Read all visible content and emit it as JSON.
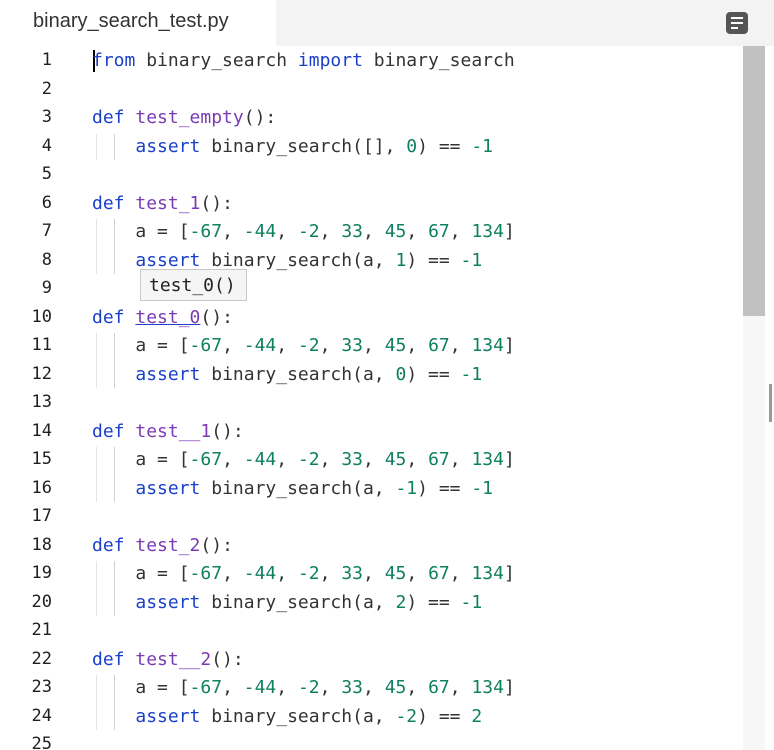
{
  "tab": {
    "title": "binary_search_test.py"
  },
  "tooltip": {
    "text": "test_0()"
  },
  "colors": {
    "keyword": "#1a3fc9",
    "function": "#7a3ab5",
    "number": "#0e7f5f",
    "text": "#333333"
  },
  "icons": {
    "outline": "outline-icon"
  },
  "lines": [
    {
      "n": "1",
      "tokens": [
        [
          "from",
          "kw"
        ],
        [
          " binary_search ",
          ""
        ],
        [
          "import",
          "kw"
        ],
        [
          " binary_search",
          ""
        ]
      ]
    },
    {
      "n": "2",
      "tokens": []
    },
    {
      "n": "3",
      "tokens": [
        [
          "def",
          "kw"
        ],
        [
          " ",
          ""
        ],
        [
          "test_empty",
          "fn"
        ],
        [
          "():",
          ""
        ]
      ]
    },
    {
      "n": "4",
      "tokens": [
        [
          "    ",
          ""
        ],
        [
          "assert",
          "kw"
        ],
        [
          " binary_search([], ",
          ""
        ],
        [
          "0",
          "num"
        ],
        [
          ") == ",
          ""
        ],
        [
          "-1",
          "num"
        ]
      ]
    },
    {
      "n": "5",
      "tokens": []
    },
    {
      "n": "6",
      "tokens": [
        [
          "def",
          "kw"
        ],
        [
          " ",
          ""
        ],
        [
          "test_1",
          "fn"
        ],
        [
          "():",
          ""
        ]
      ]
    },
    {
      "n": "7",
      "tokens": [
        [
          "    a = [",
          ""
        ],
        [
          "-67",
          "num"
        ],
        [
          ", ",
          ""
        ],
        [
          "-44",
          "num"
        ],
        [
          ", ",
          ""
        ],
        [
          "-2",
          "num"
        ],
        [
          ", ",
          ""
        ],
        [
          "33",
          "num"
        ],
        [
          ", ",
          ""
        ],
        [
          "45",
          "num"
        ],
        [
          ", ",
          ""
        ],
        [
          "67",
          "num"
        ],
        [
          ", ",
          ""
        ],
        [
          "134",
          "num"
        ],
        [
          "]",
          ""
        ]
      ]
    },
    {
      "n": "8",
      "tokens": [
        [
          "    ",
          ""
        ],
        [
          "assert",
          "kw"
        ],
        [
          " binary_search(a, ",
          ""
        ],
        [
          "1",
          "num"
        ],
        [
          ") == ",
          ""
        ],
        [
          "-1",
          "num"
        ]
      ]
    },
    {
      "n": "9",
      "tokens": []
    },
    {
      "n": "10",
      "tokens": [
        [
          "def",
          "kw"
        ],
        [
          " ",
          ""
        ],
        [
          "test_0",
          "fn ul"
        ],
        [
          "():",
          ""
        ]
      ]
    },
    {
      "n": "11",
      "tokens": [
        [
          "    a = [",
          ""
        ],
        [
          "-67",
          "num"
        ],
        [
          ", ",
          ""
        ],
        [
          "-44",
          "num"
        ],
        [
          ", ",
          ""
        ],
        [
          "-2",
          "num"
        ],
        [
          ", ",
          ""
        ],
        [
          "33",
          "num"
        ],
        [
          ", ",
          ""
        ],
        [
          "45",
          "num"
        ],
        [
          ", ",
          ""
        ],
        [
          "67",
          "num"
        ],
        [
          ", ",
          ""
        ],
        [
          "134",
          "num"
        ],
        [
          "]",
          ""
        ]
      ]
    },
    {
      "n": "12",
      "tokens": [
        [
          "    ",
          ""
        ],
        [
          "assert",
          "kw"
        ],
        [
          " binary_search(a, ",
          ""
        ],
        [
          "0",
          "num"
        ],
        [
          ") == ",
          ""
        ],
        [
          "-1",
          "num"
        ]
      ]
    },
    {
      "n": "13",
      "tokens": []
    },
    {
      "n": "14",
      "tokens": [
        [
          "def",
          "kw"
        ],
        [
          " ",
          ""
        ],
        [
          "test__1",
          "fn"
        ],
        [
          "():",
          ""
        ]
      ]
    },
    {
      "n": "15",
      "tokens": [
        [
          "    a = [",
          ""
        ],
        [
          "-67",
          "num"
        ],
        [
          ", ",
          ""
        ],
        [
          "-44",
          "num"
        ],
        [
          ", ",
          ""
        ],
        [
          "-2",
          "num"
        ],
        [
          ", ",
          ""
        ],
        [
          "33",
          "num"
        ],
        [
          ", ",
          ""
        ],
        [
          "45",
          "num"
        ],
        [
          ", ",
          ""
        ],
        [
          "67",
          "num"
        ],
        [
          ", ",
          ""
        ],
        [
          "134",
          "num"
        ],
        [
          "]",
          ""
        ]
      ]
    },
    {
      "n": "16",
      "tokens": [
        [
          "    ",
          ""
        ],
        [
          "assert",
          "kw"
        ],
        [
          " binary_search(a, ",
          ""
        ],
        [
          "-1",
          "num"
        ],
        [
          ") == ",
          ""
        ],
        [
          "-1",
          "num"
        ]
      ]
    },
    {
      "n": "17",
      "tokens": []
    },
    {
      "n": "18",
      "tokens": [
        [
          "def",
          "kw"
        ],
        [
          " ",
          ""
        ],
        [
          "test_2",
          "fn"
        ],
        [
          "():",
          ""
        ]
      ]
    },
    {
      "n": "19",
      "tokens": [
        [
          "    a = [",
          ""
        ],
        [
          "-67",
          "num"
        ],
        [
          ", ",
          ""
        ],
        [
          "-44",
          "num"
        ],
        [
          ", ",
          ""
        ],
        [
          "-2",
          "num"
        ],
        [
          ", ",
          ""
        ],
        [
          "33",
          "num"
        ],
        [
          ", ",
          ""
        ],
        [
          "45",
          "num"
        ],
        [
          ", ",
          ""
        ],
        [
          "67",
          "num"
        ],
        [
          ", ",
          ""
        ],
        [
          "134",
          "num"
        ],
        [
          "]",
          ""
        ]
      ]
    },
    {
      "n": "20",
      "tokens": [
        [
          "    ",
          ""
        ],
        [
          "assert",
          "kw"
        ],
        [
          " binary_search(a, ",
          ""
        ],
        [
          "2",
          "num"
        ],
        [
          ") == ",
          ""
        ],
        [
          "-1",
          "num"
        ]
      ]
    },
    {
      "n": "21",
      "tokens": []
    },
    {
      "n": "22",
      "tokens": [
        [
          "def",
          "kw"
        ],
        [
          " ",
          ""
        ],
        [
          "test__2",
          "fn"
        ],
        [
          "():",
          ""
        ]
      ]
    },
    {
      "n": "23",
      "tokens": [
        [
          "    a = [",
          ""
        ],
        [
          "-67",
          "num"
        ],
        [
          ", ",
          ""
        ],
        [
          "-44",
          "num"
        ],
        [
          ", ",
          ""
        ],
        [
          "-2",
          "num"
        ],
        [
          ", ",
          ""
        ],
        [
          "33",
          "num"
        ],
        [
          ", ",
          ""
        ],
        [
          "45",
          "num"
        ],
        [
          ", ",
          ""
        ],
        [
          "67",
          "num"
        ],
        [
          ", ",
          ""
        ],
        [
          "134",
          "num"
        ],
        [
          "]",
          ""
        ]
      ]
    },
    {
      "n": "24",
      "tokens": [
        [
          "    ",
          ""
        ],
        [
          "assert",
          "kw"
        ],
        [
          " binary_search(a, ",
          ""
        ],
        [
          "-2",
          "num"
        ],
        [
          ") == ",
          ""
        ],
        [
          "2",
          "num"
        ]
      ]
    },
    {
      "n": "25",
      "tokens": []
    }
  ]
}
